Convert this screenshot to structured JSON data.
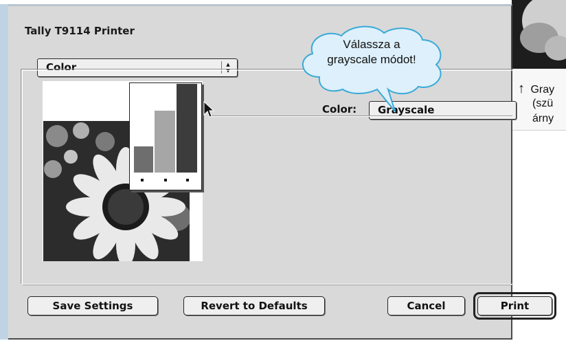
{
  "dialog": {
    "title": "Tally T9114 Printer",
    "panel_popup": {
      "value": "Color"
    },
    "color_setting": {
      "label": "Color:",
      "value": "Grayscale"
    },
    "buttons": {
      "save": "Save Settings",
      "revert": "Revert to Defaults",
      "cancel": "Cancel",
      "print": "Print"
    }
  },
  "callout": {
    "line1": "Válassza a",
    "line2": "grayscale módot!"
  },
  "side_caption": {
    "arrow": "↑",
    "line1": "Gray",
    "line2": "(szü",
    "line3": "árny"
  },
  "colors": {
    "dialog_bg": "#d9d9d9",
    "bubble_fill": "#ddf0fb",
    "bubble_stroke": "#39a9d8",
    "bar_light": "#a6a6a6",
    "bar_mid": "#6e6e6e",
    "bar_dark": "#3c3c3c"
  },
  "preview_chart": {
    "bars": [
      0.3,
      0.62,
      1.0
    ]
  }
}
